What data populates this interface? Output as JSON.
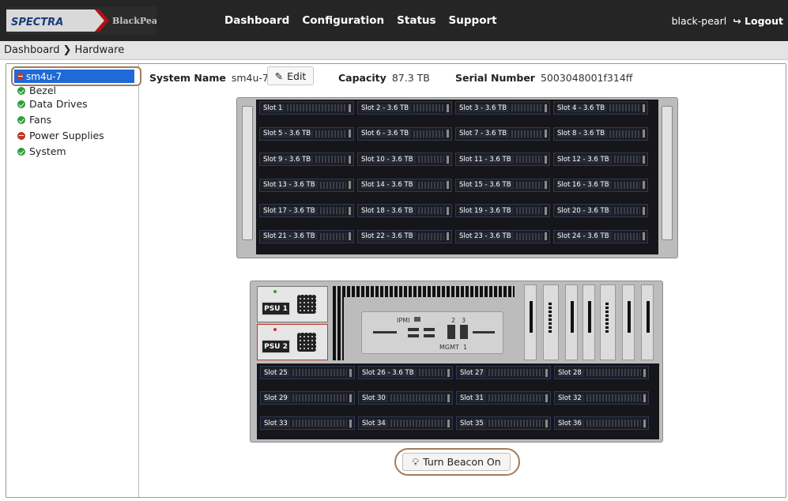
{
  "header": {
    "brand_left": "SPECTRA",
    "brand_right": "BlackPearl",
    "nav": [
      "Dashboard",
      "Configuration",
      "Status",
      "Support"
    ],
    "user": "black-pearl",
    "logout": "Logout"
  },
  "breadcrumb": {
    "root": "Dashboard",
    "current": "Hardware"
  },
  "tree": {
    "root": "sm4u-7",
    "items": [
      {
        "label": "Bezel",
        "status": "ok"
      },
      {
        "label": "Data Drives",
        "status": "ok"
      },
      {
        "label": "Fans",
        "status": "ok"
      },
      {
        "label": "Power Supplies",
        "status": "error"
      },
      {
        "label": "System",
        "status": "ok"
      }
    ]
  },
  "info": {
    "system_name_label": "System Name",
    "system_name": "sm4u-7",
    "edit_label": "Edit",
    "capacity_label": "Capacity",
    "capacity": "87.3 TB",
    "serial_label": "Serial Number",
    "serial": "5003048001f314ff"
  },
  "front_slots": [
    "Slot 1",
    "Slot 2 - 3.6 TB",
    "Slot 3 - 3.6 TB",
    "Slot 4 - 3.6 TB",
    "Slot 5 - 3.6 TB",
    "Slot 6 - 3.6 TB",
    "Slot 7 - 3.6 TB",
    "Slot 8 - 3.6 TB",
    "Slot 9 - 3.6 TB",
    "Slot 10 - 3.6 TB",
    "Slot 11 - 3.6 TB",
    "Slot 12 - 3.6 TB",
    "Slot 13 - 3.6 TB",
    "Slot 14 - 3.6 TB",
    "Slot 15 - 3.6 TB",
    "Slot 16 - 3.6 TB",
    "Slot 17 - 3.6 TB",
    "Slot 18 - 3.6 TB",
    "Slot 19 - 3.6 TB",
    "Slot 20 - 3.6 TB",
    "Slot 21 - 3.6 TB",
    "Slot 22 - 3.6 TB",
    "Slot 23 - 3.6 TB",
    "Slot 24 - 3.6 TB"
  ],
  "rear": {
    "psu1": "PSU 1",
    "psu2": "PSU 2",
    "ipmi": "IPMI",
    "mgmt": "MGMT",
    "port2": "2",
    "port3": "3",
    "port1": "1",
    "slots": [
      "Slot 25",
      "Slot 26 - 3.6 TB",
      "Slot 27",
      "Slot 28",
      "Slot 29",
      "Slot 30",
      "Slot 31",
      "Slot 32",
      "Slot 33",
      "Slot 34",
      "Slot 35",
      "Slot 36"
    ]
  },
  "beacon_label": "Turn Beacon On",
  "colors": {
    "selected": "#1e6ad6",
    "ok": "#2e9d3a",
    "error": "#c0392b",
    "header": "#252525"
  }
}
